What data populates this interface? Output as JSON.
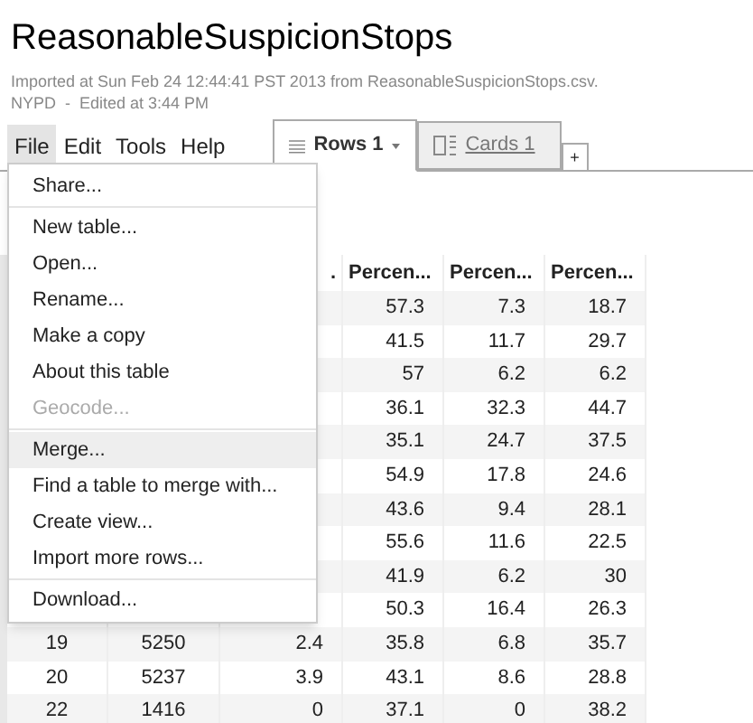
{
  "title": "ReasonableSuspicionStops",
  "subtitle": [
    "Imported at Sun Feb 24 12:44:41 PST 2013 from ReasonableSuspicionStops.csv.",
    "NYPD  -  Edited at 3:44 PM"
  ],
  "menubar": [
    {
      "label": "File",
      "selected": true
    },
    {
      "label": "Edit",
      "selected": false
    },
    {
      "label": "Tools",
      "selected": false
    },
    {
      "label": "Help",
      "selected": false
    }
  ],
  "tabs": [
    {
      "label": "Rows 1",
      "kind": "rows",
      "selected": true
    },
    {
      "label": "Cards 1",
      "kind": "cards",
      "selected": false
    }
  ],
  "add_tab": "+",
  "file_menu": [
    {
      "label": "Share...",
      "disabled": false,
      "selected": false,
      "separator_after": true
    },
    {
      "label": "New table...",
      "disabled": false,
      "selected": false,
      "separator_after": false
    },
    {
      "label": "Open...",
      "disabled": false,
      "selected": false,
      "separator_after": false
    },
    {
      "label": "Rename...",
      "disabled": false,
      "selected": false,
      "separator_after": false
    },
    {
      "label": "Make a copy",
      "disabled": false,
      "selected": false,
      "separator_after": false
    },
    {
      "label": "About this table",
      "disabled": false,
      "selected": false,
      "separator_after": false
    },
    {
      "label": "Geocode...",
      "disabled": true,
      "selected": false,
      "separator_after": true
    },
    {
      "label": "Merge...",
      "disabled": false,
      "selected": true,
      "separator_after": false
    },
    {
      "label": "Find a table to merge with...",
      "disabled": false,
      "selected": false,
      "separator_after": false
    },
    {
      "label": "Create view...",
      "disabled": false,
      "selected": false,
      "separator_after": false
    },
    {
      "label": "Import more rows...",
      "disabled": false,
      "selected": false,
      "separator_after": true
    },
    {
      "label": "Download...",
      "disabled": false,
      "selected": false,
      "separator_after": false
    }
  ],
  "table": {
    "columns": [
      "",
      "",
      ".",
      "Percen...",
      "Percen...",
      "Percen..."
    ],
    "rows": [
      {
        "cells": [
          "",
          "",
          "",
          "57.3",
          "7.3",
          "18.7"
        ]
      },
      {
        "cells": [
          "",
          "",
          "",
          "41.5",
          "11.7",
          "29.7"
        ]
      },
      {
        "cells": [
          "",
          "",
          "",
          "57",
          "6.2",
          "6.2"
        ]
      },
      {
        "cells": [
          "",
          "",
          "",
          "36.1",
          "32.3",
          "44.7"
        ]
      },
      {
        "cells": [
          "",
          "",
          "",
          "35.1",
          "24.7",
          "37.5"
        ]
      },
      {
        "cells": [
          "",
          "",
          "",
          "54.9",
          "17.8",
          "24.6"
        ]
      },
      {
        "cells": [
          "",
          "",
          "",
          "43.6",
          "9.4",
          "28.1"
        ]
      },
      {
        "cells": [
          "",
          "",
          "",
          "55.6",
          "11.6",
          "22.5"
        ]
      },
      {
        "cells": [
          "",
          "",
          "",
          "41.9",
          "6.2",
          "30"
        ]
      },
      {
        "cells": [
          "",
          "",
          "",
          "50.3",
          "16.4",
          "26.3"
        ]
      },
      {
        "cells": [
          "19",
          "5250",
          "2.4",
          "35.8",
          "6.8",
          "35.7"
        ]
      },
      {
        "cells": [
          "20",
          "5237",
          "3.9",
          "43.1",
          "8.6",
          "28.8"
        ]
      },
      {
        "cells": [
          "22",
          "1416",
          "0",
          "37.1",
          "0",
          "38.2"
        ]
      }
    ]
  }
}
